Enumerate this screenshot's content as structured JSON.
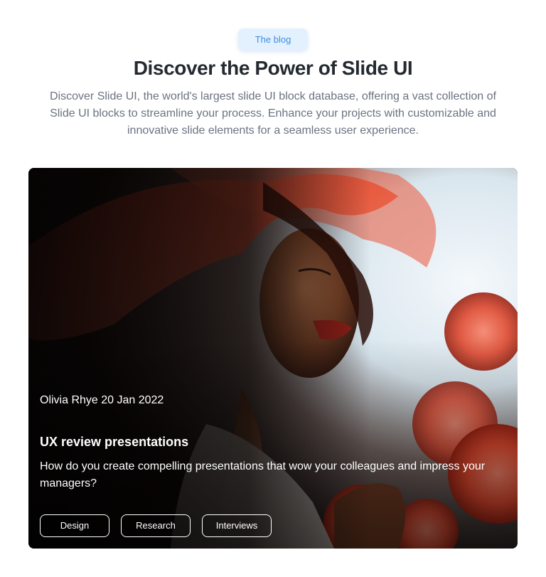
{
  "header": {
    "badge": "The blog",
    "title": "Discover the Power of Slide UI",
    "subtitle": "Discover Slide UI, the world's largest slide UI block database, offering a vast collection of Slide UI blocks to streamline your process. Enhance your projects with customizable and innovative slide elements for a seamless user experience."
  },
  "post": {
    "meta": "Olivia Rhye 20 Jan 2022",
    "title": "UX review presentations",
    "description": "How do you create compelling presentations that wow your colleagues and impress your managers?",
    "tags": [
      "Design",
      "Research",
      "Interviews"
    ]
  },
  "colors": {
    "accent": "#3d8fe0",
    "badge_bg": "#e3f0fd",
    "title": "#252a31",
    "subtitle": "#6b7280"
  }
}
